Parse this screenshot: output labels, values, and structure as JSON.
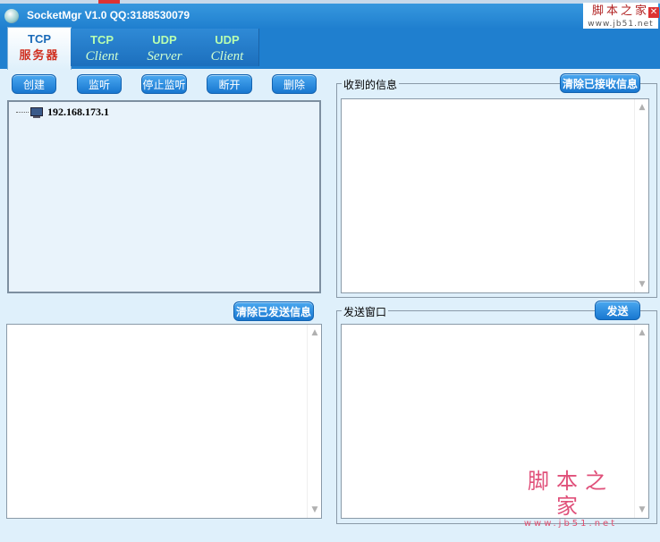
{
  "window": {
    "title": "SocketMgr V1.0  QQ:3188530079",
    "close_glyph": "✕"
  },
  "watermark": {
    "top_line1": "脚本之家",
    "top_line2": "www.jb51.net",
    "bottom_line1": "脚本之家",
    "bottom_line2": "www.jb51.net"
  },
  "tabs": [
    {
      "line1": "TCP",
      "line2": "服务器",
      "active": true
    },
    {
      "line1": "TCP",
      "line2": "Client",
      "active": false
    },
    {
      "line1": "UDP",
      "line2": "Server",
      "active": false
    },
    {
      "line1": "UDP",
      "line2": "Client",
      "active": false
    }
  ],
  "toolbar": {
    "create": "创建",
    "listen": "监听",
    "stop_listen": "停止监听",
    "disconnect": "断开",
    "delete": "删除"
  },
  "tree": {
    "items": [
      {
        "label": "192.168.173.1",
        "icon": "computer-icon"
      }
    ]
  },
  "received": {
    "legend": "收到的信息",
    "clear_button": "清除已接收信息",
    "content": ""
  },
  "sent": {
    "clear_button": "清除已发送信息",
    "content": ""
  },
  "send_window": {
    "legend": "发送窗口",
    "send_button": "发送",
    "content": ""
  },
  "scroll": {
    "up": "▲",
    "down": "▼"
  },
  "colors": {
    "titlebar": "#1f7fcf",
    "background": "#dff0fb",
    "button": "#1877d0",
    "active_tab_text": "#d03020"
  }
}
